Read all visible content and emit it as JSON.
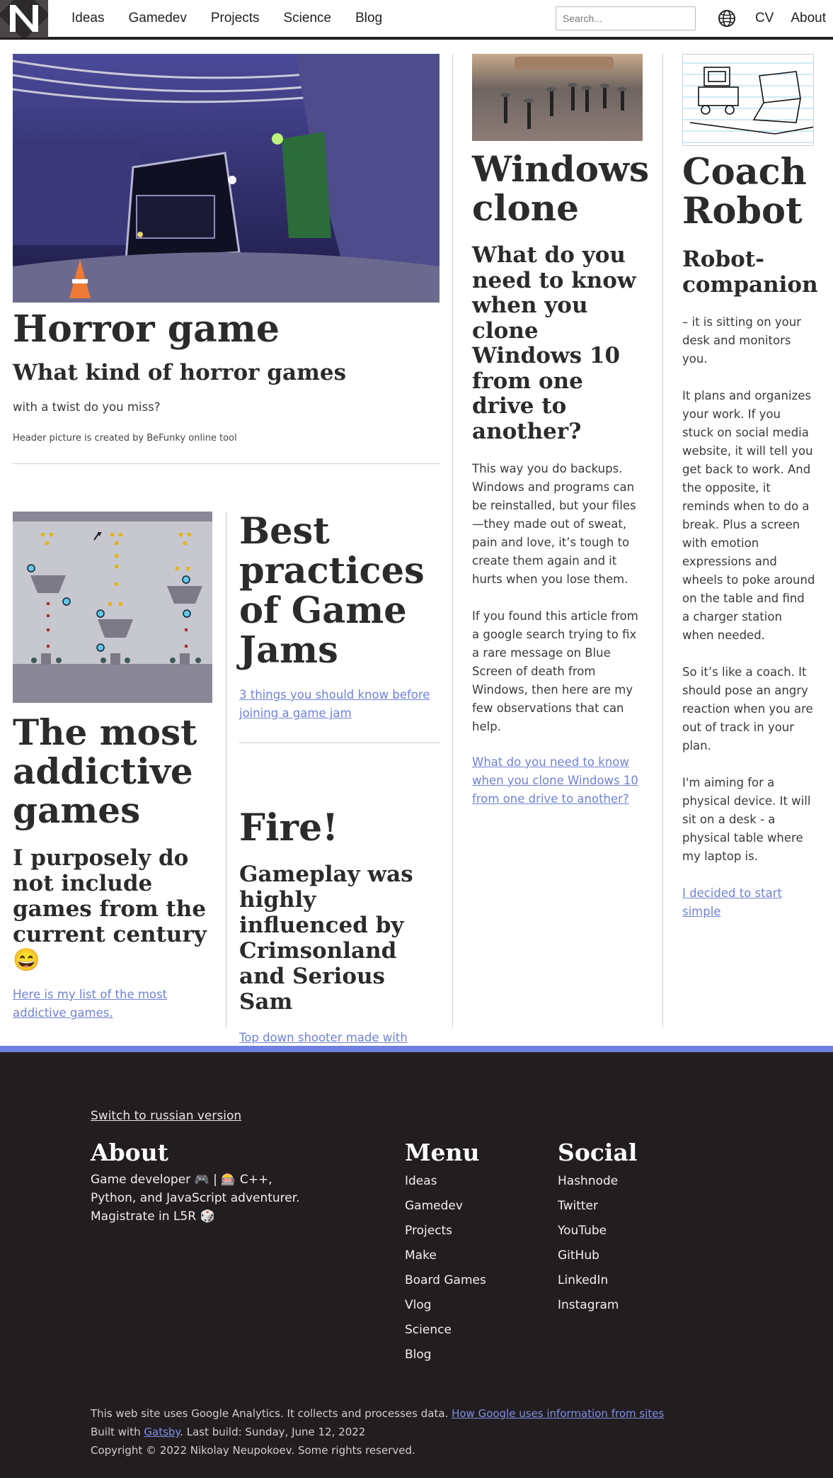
{
  "header": {
    "nav_left": [
      "Ideas",
      "Gamedev",
      "Projects",
      "Science",
      "Blog"
    ],
    "search_placeholder": "Search...",
    "nav_right": [
      "CV",
      "About"
    ]
  },
  "horror": {
    "title": "Horror game",
    "subtitle": "What kind of horror games",
    "text": "with a twist do you miss?",
    "credit": "Header picture is created by BeFunky online tool"
  },
  "addictive": {
    "title": "The most addictive games",
    "subtitle": "I purposely do not include games from the current century 😄",
    "link": "Here is my list of the most addictive games."
  },
  "gamejams": {
    "title": "Best practices of Game Jams",
    "link": "3 things you should know before joining a game jam"
  },
  "fire": {
    "title": "Fire!",
    "subtitle": "Gameplay was highly influenced by Crimsonland and Serious Sam",
    "link": "Top down shooter made with Game Maker"
  },
  "windows": {
    "title": "Windows clone",
    "subtitle": "What do you need to know when you clone Windows 10 from one drive to another?",
    "p1": "This way you do backups. Windows and programs can be reinstalled, but your files—they made out of sweat, pain and love, it’s tough to create them again and it hurts when you lose them.",
    "p2": "If you found this article from a google search trying to fix a rare message on Blue Screen of death from Windows, then here are my few observations that can help.",
    "link": "What do you need to know when you clone Windows 10 from one drive to another?"
  },
  "coach": {
    "title": "Coach Robot",
    "subtitle": "Robot-companion",
    "p1": "– it is sitting on your desk and monitors you.",
    "p2": "It plans and organizes your work. If you stuck on social media website, it will tell you get back to work. And the opposite, it reminds when to do a break. Plus a screen with emotion expressions and wheels to poke around on the table and find a charger station when needed.",
    "p3": "So it’s like a coach. It should pose an angry reaction when you are out of track in your plan.",
    "p4": "I'm aiming for a physical device. It will sit on a desk - a physical table where my laptop is.",
    "link": "I decided to start simple"
  },
  "footer": {
    "switch": "Switch to russian version",
    "about_title": "About",
    "about_text": "Game developer 🎮 | 🎰 C++, Python, and JavaScript adventurer. Magistrate in L5R 🎲",
    "menu_title": "Menu",
    "menu": [
      "Ideas",
      "Gamedev",
      "Projects",
      "Make",
      "Board Games",
      "Vlog",
      "Science",
      "Blog"
    ],
    "social_title": "Social",
    "social": [
      "Hashnode",
      "Twitter",
      "YouTube",
      "GitHub",
      "LinkedIn",
      "Instagram"
    ],
    "analytics_text": "This web site uses Google Analytics. It collects and processes data.",
    "analytics_link": "How Google uses information from sites",
    "built_prefix": "Built with",
    "built_link": "Gatsby",
    "built_suffix": ". Last build: Sunday, June 12, 2022",
    "copyright": "Copyright © 2022 Nikolay Neupokoev. Some rights reserved."
  }
}
